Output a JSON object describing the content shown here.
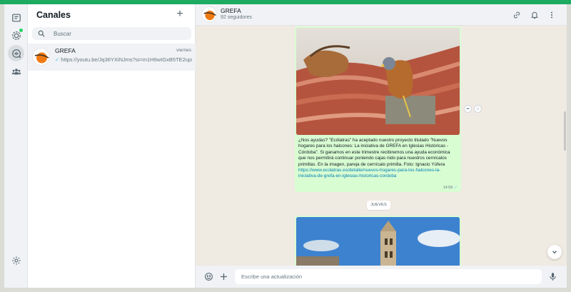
{
  "colors": {
    "accent": "#1daa61",
    "bubble": "#d9fdd3",
    "link": "#027eb5",
    "chat_bg": "#efeae2"
  },
  "rail": {
    "icons": [
      "chats-icon",
      "status-icon",
      "channels-icon",
      "communities-icon",
      "settings-icon"
    ],
    "active": "channels-icon"
  },
  "panel": {
    "title": "Canales",
    "search_placeholder": "Buscar",
    "channels": [
      {
        "name": "GREFA",
        "time": "viernes",
        "preview": "https://youtu.be/Jq36YXiNJms?si=m1H6wIGxB5TE2upL"
      }
    ]
  },
  "header": {
    "name": "GREFA",
    "followers": "92 seguidores"
  },
  "messages": {
    "post1": {
      "caption": "¿Nos ayudas? \"Ecólatras\" ha aceptado nuestro proyecto titulado \"Nuevos hogares para los halcones: La iniciativa de GREFA en Iglesias Históricas - Córdoba\". Si ganamos en este trimestre recibiremos una ayuda económica que nos permitirá continuar poniendo cajas nido para nuestros cernícalos primillas. En la imagen, pareja de cernícalo primilla. Foto: Ignacio Yúfera ",
      "link": "https://www.ecolatras.es/detalle/nuevos-hogares-para-los-halcones-la-iniciativa-de-grefa-en-iglesias-historicas-cordoba",
      "time": "14:56"
    },
    "day_separator": "JUEVES"
  },
  "composer": {
    "placeholder": "Escribe una actualización"
  }
}
